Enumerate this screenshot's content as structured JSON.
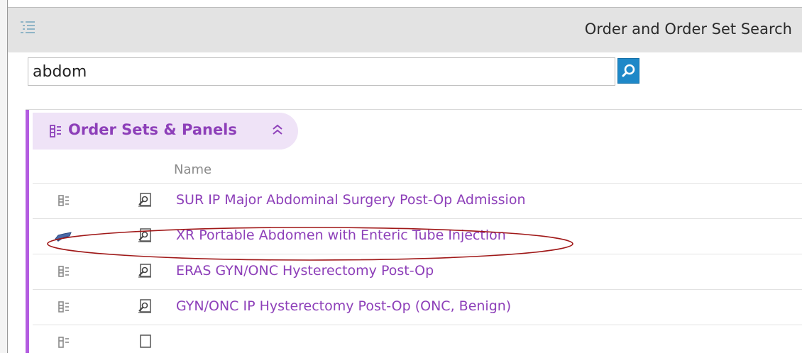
{
  "window": {
    "title": "Order and Order Set Search"
  },
  "search": {
    "query": "abdom",
    "button_icon": "magnifier-icon"
  },
  "section": {
    "title": "Order Sets & Panels",
    "column_name": "Name"
  },
  "rows": [
    {
      "name": "SUR IP Major Abdominal Surgery Post-Op Admission",
      "type_icon": "order-set-icon"
    },
    {
      "name": "XR Portable Abdomen with Enteric Tube Injection",
      "type_icon": "portable-xray-icon",
      "highlighted": true
    },
    {
      "name": "ERAS GYN/ONC Hysterectomy Post-Op",
      "type_icon": "order-set-icon"
    },
    {
      "name": "GYN/ONC IP Hysterectomy Post-Op (ONC, Benign)",
      "type_icon": "order-set-icon"
    }
  ],
  "colors": {
    "accent_purple": "#8d3fb9",
    "section_bar": "#b35ce0",
    "header_bg": "#efe3f7",
    "search_button": "#1e88c8",
    "annotation_red": "#a01818"
  }
}
